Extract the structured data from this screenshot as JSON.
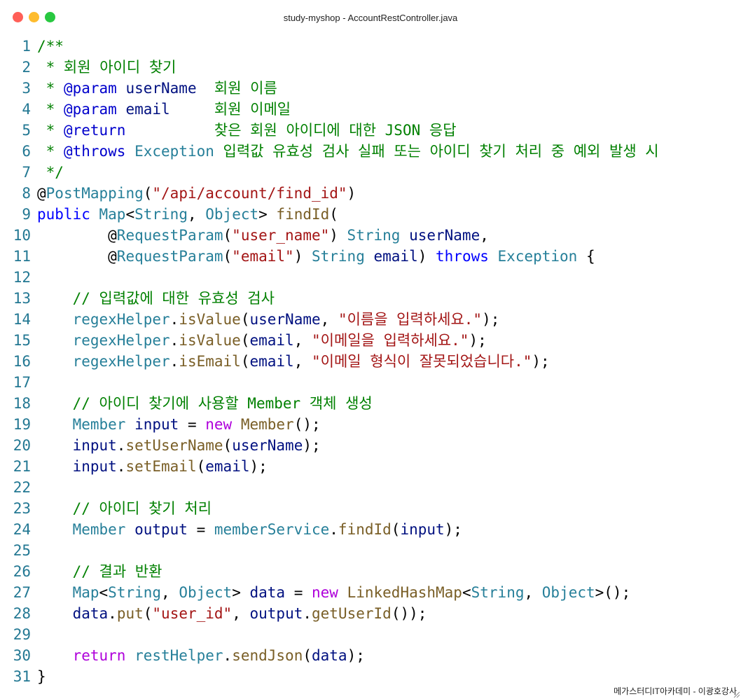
{
  "window": {
    "title": "study-myshop - AccountRestController.java",
    "footer": "메가스터디IT아카데미 - 이광호강사"
  },
  "colors": {
    "comment": "#008000",
    "doc_tag": "#0000cc",
    "keyword": "#0000ff",
    "control": "#af00db",
    "type": "#267f99",
    "function": "#795e26",
    "string": "#a31515",
    "variable": "#001080",
    "plain": "#000000",
    "line_number": "#237893"
  },
  "code_lines": [
    [
      {
        "t": "/**",
        "c": "comment"
      }
    ],
    [
      {
        "t": " * 회원 아이디 찾기",
        "c": "comment"
      }
    ],
    [
      {
        "t": " * ",
        "c": "comment"
      },
      {
        "t": "@param",
        "c": "doc_tag"
      },
      {
        "t": " ",
        "c": "comment"
      },
      {
        "t": "userName",
        "c": "variable"
      },
      {
        "t": "  회원 이름",
        "c": "comment"
      }
    ],
    [
      {
        "t": " * ",
        "c": "comment"
      },
      {
        "t": "@param",
        "c": "doc_tag"
      },
      {
        "t": " ",
        "c": "comment"
      },
      {
        "t": "email",
        "c": "variable"
      },
      {
        "t": "     회원 이메일",
        "c": "comment"
      }
    ],
    [
      {
        "t": " * ",
        "c": "comment"
      },
      {
        "t": "@return",
        "c": "doc_tag"
      },
      {
        "t": "          찾은 회원 아이디에 대한 JSON 응답",
        "c": "comment"
      }
    ],
    [
      {
        "t": " * ",
        "c": "comment"
      },
      {
        "t": "@throws",
        "c": "doc_tag"
      },
      {
        "t": " ",
        "c": "comment"
      },
      {
        "t": "Exception",
        "c": "type"
      },
      {
        "t": " 입력값 유효성 검사 실패 또는 아이디 찾기 처리 중 예외 발생 시",
        "c": "comment"
      }
    ],
    [
      {
        "t": " */",
        "c": "comment"
      }
    ],
    [
      {
        "t": "@",
        "c": "plain"
      },
      {
        "t": "PostMapping",
        "c": "type"
      },
      {
        "t": "(",
        "c": "plain"
      },
      {
        "t": "\"/api/account/find_id\"",
        "c": "string"
      },
      {
        "t": ")",
        "c": "plain"
      }
    ],
    [
      {
        "t": "public",
        "c": "keyword"
      },
      {
        "t": " ",
        "c": "plain"
      },
      {
        "t": "Map",
        "c": "type"
      },
      {
        "t": "<",
        "c": "plain"
      },
      {
        "t": "String",
        "c": "type"
      },
      {
        "t": ", ",
        "c": "plain"
      },
      {
        "t": "Object",
        "c": "type"
      },
      {
        "t": "> ",
        "c": "plain"
      },
      {
        "t": "findId",
        "c": "function"
      },
      {
        "t": "(",
        "c": "plain"
      }
    ],
    [
      {
        "t": "        @",
        "c": "plain"
      },
      {
        "t": "RequestParam",
        "c": "type"
      },
      {
        "t": "(",
        "c": "plain"
      },
      {
        "t": "\"user_name\"",
        "c": "string"
      },
      {
        "t": ") ",
        "c": "plain"
      },
      {
        "t": "String",
        "c": "type"
      },
      {
        "t": " ",
        "c": "plain"
      },
      {
        "t": "userName",
        "c": "variable"
      },
      {
        "t": ",",
        "c": "plain"
      }
    ],
    [
      {
        "t": "        @",
        "c": "plain"
      },
      {
        "t": "RequestParam",
        "c": "type"
      },
      {
        "t": "(",
        "c": "plain"
      },
      {
        "t": "\"email\"",
        "c": "string"
      },
      {
        "t": ") ",
        "c": "plain"
      },
      {
        "t": "String",
        "c": "type"
      },
      {
        "t": " ",
        "c": "plain"
      },
      {
        "t": "email",
        "c": "variable"
      },
      {
        "t": ") ",
        "c": "plain"
      },
      {
        "t": "throws",
        "c": "keyword"
      },
      {
        "t": " ",
        "c": "plain"
      },
      {
        "t": "Exception",
        "c": "type"
      },
      {
        "t": " {",
        "c": "plain"
      }
    ],
    [],
    [
      {
        "t": "    // 입력값에 대한 유효성 검사",
        "c": "comment"
      }
    ],
    [
      {
        "t": "    ",
        "c": "plain"
      },
      {
        "t": "regexHelper",
        "c": "type"
      },
      {
        "t": ".",
        "c": "plain"
      },
      {
        "t": "isValue",
        "c": "function"
      },
      {
        "t": "(",
        "c": "plain"
      },
      {
        "t": "userName",
        "c": "variable"
      },
      {
        "t": ", ",
        "c": "plain"
      },
      {
        "t": "\"이름을 입력하세요.\"",
        "c": "string"
      },
      {
        "t": ");",
        "c": "plain"
      }
    ],
    [
      {
        "t": "    ",
        "c": "plain"
      },
      {
        "t": "regexHelper",
        "c": "type"
      },
      {
        "t": ".",
        "c": "plain"
      },
      {
        "t": "isValue",
        "c": "function"
      },
      {
        "t": "(",
        "c": "plain"
      },
      {
        "t": "email",
        "c": "variable"
      },
      {
        "t": ", ",
        "c": "plain"
      },
      {
        "t": "\"이메일을 입력하세요.\"",
        "c": "string"
      },
      {
        "t": ");",
        "c": "plain"
      }
    ],
    [
      {
        "t": "    ",
        "c": "plain"
      },
      {
        "t": "regexHelper",
        "c": "type"
      },
      {
        "t": ".",
        "c": "plain"
      },
      {
        "t": "isEmail",
        "c": "function"
      },
      {
        "t": "(",
        "c": "plain"
      },
      {
        "t": "email",
        "c": "variable"
      },
      {
        "t": ", ",
        "c": "plain"
      },
      {
        "t": "\"이메일 형식이 잘못되었습니다.\"",
        "c": "string"
      },
      {
        "t": ");",
        "c": "plain"
      }
    ],
    [],
    [
      {
        "t": "    // 아이디 찾기에 사용할 Member 객체 생성",
        "c": "comment"
      }
    ],
    [
      {
        "t": "    ",
        "c": "plain"
      },
      {
        "t": "Member",
        "c": "type"
      },
      {
        "t": " ",
        "c": "plain"
      },
      {
        "t": "input",
        "c": "variable"
      },
      {
        "t": " = ",
        "c": "plain"
      },
      {
        "t": "new",
        "c": "control"
      },
      {
        "t": " ",
        "c": "plain"
      },
      {
        "t": "Member",
        "c": "function"
      },
      {
        "t": "();",
        "c": "plain"
      }
    ],
    [
      {
        "t": "    ",
        "c": "plain"
      },
      {
        "t": "input",
        "c": "variable"
      },
      {
        "t": ".",
        "c": "plain"
      },
      {
        "t": "setUserName",
        "c": "function"
      },
      {
        "t": "(",
        "c": "plain"
      },
      {
        "t": "userName",
        "c": "variable"
      },
      {
        "t": ");",
        "c": "plain"
      }
    ],
    [
      {
        "t": "    ",
        "c": "plain"
      },
      {
        "t": "input",
        "c": "variable"
      },
      {
        "t": ".",
        "c": "plain"
      },
      {
        "t": "setEmail",
        "c": "function"
      },
      {
        "t": "(",
        "c": "plain"
      },
      {
        "t": "email",
        "c": "variable"
      },
      {
        "t": ");",
        "c": "plain"
      }
    ],
    [],
    [
      {
        "t": "    // 아이디 찾기 처리",
        "c": "comment"
      }
    ],
    [
      {
        "t": "    ",
        "c": "plain"
      },
      {
        "t": "Member",
        "c": "type"
      },
      {
        "t": " ",
        "c": "plain"
      },
      {
        "t": "output",
        "c": "variable"
      },
      {
        "t": " = ",
        "c": "plain"
      },
      {
        "t": "memberService",
        "c": "type"
      },
      {
        "t": ".",
        "c": "plain"
      },
      {
        "t": "findId",
        "c": "function"
      },
      {
        "t": "(",
        "c": "plain"
      },
      {
        "t": "input",
        "c": "variable"
      },
      {
        "t": ");",
        "c": "plain"
      }
    ],
    [],
    [
      {
        "t": "    // 결과 반환",
        "c": "comment"
      }
    ],
    [
      {
        "t": "    ",
        "c": "plain"
      },
      {
        "t": "Map",
        "c": "type"
      },
      {
        "t": "<",
        "c": "plain"
      },
      {
        "t": "String",
        "c": "type"
      },
      {
        "t": ", ",
        "c": "plain"
      },
      {
        "t": "Object",
        "c": "type"
      },
      {
        "t": "> ",
        "c": "plain"
      },
      {
        "t": "data",
        "c": "variable"
      },
      {
        "t": " = ",
        "c": "plain"
      },
      {
        "t": "new",
        "c": "control"
      },
      {
        "t": " ",
        "c": "plain"
      },
      {
        "t": "LinkedHashMap",
        "c": "function"
      },
      {
        "t": "<",
        "c": "plain"
      },
      {
        "t": "String",
        "c": "type"
      },
      {
        "t": ", ",
        "c": "plain"
      },
      {
        "t": "Object",
        "c": "type"
      },
      {
        "t": ">();",
        "c": "plain"
      }
    ],
    [
      {
        "t": "    ",
        "c": "plain"
      },
      {
        "t": "data",
        "c": "variable"
      },
      {
        "t": ".",
        "c": "plain"
      },
      {
        "t": "put",
        "c": "function"
      },
      {
        "t": "(",
        "c": "plain"
      },
      {
        "t": "\"user_id\"",
        "c": "string"
      },
      {
        "t": ", ",
        "c": "plain"
      },
      {
        "t": "output",
        "c": "variable"
      },
      {
        "t": ".",
        "c": "plain"
      },
      {
        "t": "getUserId",
        "c": "function"
      },
      {
        "t": "());",
        "c": "plain"
      }
    ],
    [],
    [
      {
        "t": "    ",
        "c": "plain"
      },
      {
        "t": "return",
        "c": "control"
      },
      {
        "t": " ",
        "c": "plain"
      },
      {
        "t": "restHelper",
        "c": "type"
      },
      {
        "t": ".",
        "c": "plain"
      },
      {
        "t": "sendJson",
        "c": "function"
      },
      {
        "t": "(",
        "c": "plain"
      },
      {
        "t": "data",
        "c": "variable"
      },
      {
        "t": ");",
        "c": "plain"
      }
    ],
    [
      {
        "t": "}",
        "c": "plain"
      }
    ]
  ]
}
